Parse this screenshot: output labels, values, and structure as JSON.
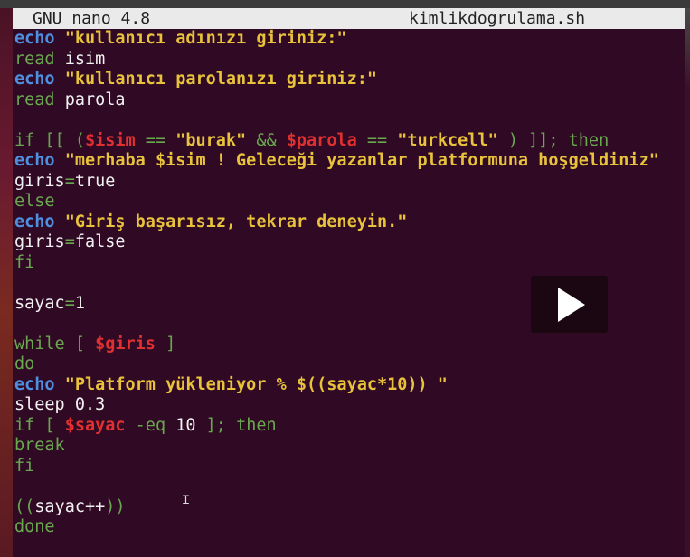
{
  "titlebar": {
    "app": "GNU nano 4.8",
    "filename": "kimlikdogrulama.sh"
  },
  "lines": [
    [
      {
        "c": "kw-blue",
        "t": "echo"
      },
      {
        "c": "txt",
        "t": " "
      },
      {
        "c": "str",
        "t": "\"kullanıcı adınızı giriniz:\""
      }
    ],
    [
      {
        "c": "kw-green",
        "t": "read"
      },
      {
        "c": "txt",
        "t": " isim"
      }
    ],
    [
      {
        "c": "kw-blue",
        "t": "echo"
      },
      {
        "c": "txt",
        "t": " "
      },
      {
        "c": "str",
        "t": "\"kullanıcı parolanızı giriniz:\""
      }
    ],
    [
      {
        "c": "kw-green",
        "t": "read"
      },
      {
        "c": "txt",
        "t": " parola"
      }
    ],
    [],
    [
      {
        "c": "kw-green",
        "t": "if [[ ("
      },
      {
        "c": "var",
        "t": "$isim"
      },
      {
        "c": "kw-green",
        "t": " == "
      },
      {
        "c": "str",
        "t": "\"burak\""
      },
      {
        "c": "kw-green",
        "t": " && "
      },
      {
        "c": "var",
        "t": "$parola"
      },
      {
        "c": "kw-green",
        "t": " == "
      },
      {
        "c": "str",
        "t": "\"turkcell\""
      },
      {
        "c": "kw-green",
        "t": " ) ]]; then"
      }
    ],
    [
      {
        "c": "kw-blue",
        "t": "echo"
      },
      {
        "c": "txt",
        "t": " "
      },
      {
        "c": "str",
        "t": "\"merhaba $isim ! Geleceği yazanlar platformuna hoşgeldiniz\""
      }
    ],
    [
      {
        "c": "txt",
        "t": "giris"
      },
      {
        "c": "op",
        "t": "="
      },
      {
        "c": "txt",
        "t": "true"
      }
    ],
    [
      {
        "c": "kw-green",
        "t": "else"
      }
    ],
    [
      {
        "c": "kw-blue",
        "t": "echo"
      },
      {
        "c": "txt",
        "t": " "
      },
      {
        "c": "str",
        "t": "\"Giriş başarısız, tekrar deneyin.\""
      }
    ],
    [
      {
        "c": "txt",
        "t": "giris"
      },
      {
        "c": "op",
        "t": "="
      },
      {
        "c": "txt",
        "t": "false"
      }
    ],
    [
      {
        "c": "kw-green",
        "t": "fi"
      }
    ],
    [],
    [
      {
        "c": "txt",
        "t": "sayac"
      },
      {
        "c": "op",
        "t": "="
      },
      {
        "c": "txt",
        "t": "1"
      }
    ],
    [],
    [
      {
        "c": "kw-green",
        "t": "while [ "
      },
      {
        "c": "var",
        "t": "$giris"
      },
      {
        "c": "kw-green",
        "t": " ]"
      }
    ],
    [
      {
        "c": "kw-green",
        "t": "do"
      }
    ],
    [
      {
        "c": "kw-blue",
        "t": "echo"
      },
      {
        "c": "txt",
        "t": " "
      },
      {
        "c": "str",
        "t": "\"Platform yükleniyor % $((sayac*10)) \""
      }
    ],
    [
      {
        "c": "txt",
        "t": "sleep 0.3"
      }
    ],
    [
      {
        "c": "kw-green",
        "t": "if [ "
      },
      {
        "c": "var",
        "t": "$sayac"
      },
      {
        "c": "kw-green",
        "t": " -eq "
      },
      {
        "c": "txt",
        "t": "10"
      },
      {
        "c": "kw-green",
        "t": " ]; then"
      }
    ],
    [
      {
        "c": "kw-green",
        "t": "break"
      }
    ],
    [
      {
        "c": "kw-green",
        "t": "fi"
      }
    ],
    [],
    [
      {
        "c": "kw-green",
        "t": "(("
      },
      {
        "c": "txt",
        "t": "sayac++"
      },
      {
        "c": "kw-green",
        "t": "))"
      }
    ],
    [
      {
        "c": "kw-green",
        "t": "done"
      }
    ]
  ],
  "overlay": {
    "play_icon": "play-icon",
    "cursor_icon": "text-cursor-icon"
  },
  "colors": {
    "terminal_bg": "#300a24",
    "keyword_blue": "#4f8fe0",
    "keyword_green": "#6aa84f",
    "string": "#e8c23a",
    "variable": "#e03030"
  }
}
